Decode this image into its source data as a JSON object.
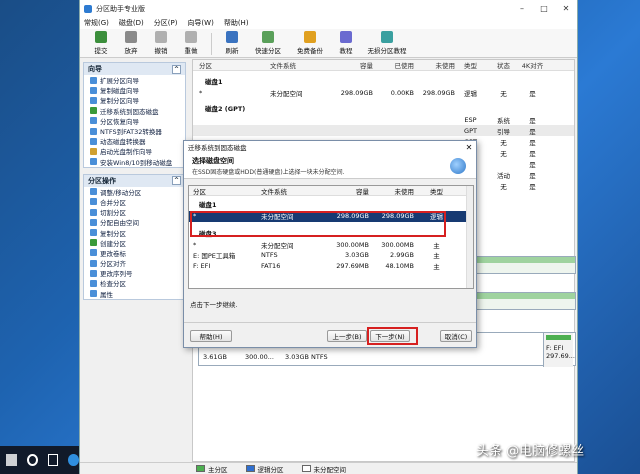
{
  "app": {
    "title": "分区助手专业版",
    "menu": [
      "常规(G)",
      "磁盘(D)",
      "分区(P)",
      "向导(W)",
      "帮助(H)"
    ],
    "toolbar": [
      "提交",
      "放弃",
      "撤销",
      "重做",
      "刷新",
      "快速分区",
      "免费备份",
      "教程",
      "无损分区教程"
    ]
  },
  "sidebar": {
    "wizard": {
      "title": "向导",
      "items": [
        "扩展分区向导",
        "复制磁盘向导",
        "复制分区向导",
        "迁移系统到固态磁盘",
        "分区恢复向导",
        "NTFS到FAT32转换器",
        "动态磁盘转换器",
        "启动光盘制作向导",
        "安装Win8/10到移动磁盘"
      ]
    },
    "ops": {
      "title": "分区操作",
      "items": [
        "调整/移动分区",
        "合并分区",
        "切割分区",
        "分配自由空间",
        "复制分区",
        "创建分区",
        "更改卷标",
        "分区对齐",
        "更改序列号",
        "检查分区",
        "属性"
      ]
    }
  },
  "grid": {
    "columns": [
      "分区",
      "文件系统",
      "容量",
      "已使用",
      "未使用",
      "类型",
      "状态",
      "4K对齐"
    ],
    "disk1_label": "磁盘1",
    "disk1_rows": [
      [
        "*",
        "未分配空间",
        "298.09GB",
        "0.00KB",
        "298.09GB",
        "逻辑",
        "无",
        "是"
      ]
    ],
    "disk2_label": "磁盘2 (GPT)",
    "disk2_rows": [
      [
        "",
        "",
        "",
        "",
        "",
        "ESP",
        "系统",
        "是"
      ],
      [
        "",
        "",
        "",
        "",
        "",
        "GPT",
        "引导",
        "是"
      ],
      [
        "",
        "",
        "",
        "",
        "",
        "GPT",
        "无",
        "是"
      ],
      [
        "",
        "",
        "",
        "",
        "",
        "逻辑",
        "无",
        "是"
      ],
      [
        "",
        "",
        "",
        "",
        "",
        "",
        "",
        "是"
      ],
      [
        "",
        "",
        "",
        "",
        "",
        "主",
        "活动",
        "是"
      ],
      [
        "",
        "",
        "",
        "",
        "",
        "主",
        "无",
        "是"
      ]
    ]
  },
  "map": {
    "bottom_left": "3.61GB",
    "bottom_mid": "300.00...",
    "bottom_fs": "3.03GB NTFS",
    "right_label": "F: EFI",
    "right_size": "297.69..."
  },
  "statusbar": {
    "legend": [
      "主分区",
      "逻辑分区",
      "未分配空间"
    ]
  },
  "dialog": {
    "title": "迁移系统到固态磁盘",
    "heading": "选择磁盘空间",
    "subheading": "在SSD固态硬盘或HDD(普通硬盘)上选择一块未分配空间.",
    "columns": [
      "分区",
      "文件系统",
      "容量",
      "未使用",
      "类型"
    ],
    "disk1_label": "磁盘1",
    "disk1_rows": [
      [
        "*",
        "未分配空间",
        "298.09GB",
        "298.09GB",
        "逻辑"
      ]
    ],
    "disk3_label": "磁盘3",
    "disk3_rows": [
      [
        "*",
        "未分配空间",
        "300.00MB",
        "300.00MB",
        "主"
      ],
      [
        "E: 国PE工具箱",
        "NTFS",
        "3.03GB",
        "2.99GB",
        "主"
      ],
      [
        "F: EFI",
        "FAT16",
        "297.69MB",
        "48.10MB",
        "主"
      ]
    ],
    "note": "点击下一步继续.",
    "help": "帮助(H)",
    "prev": "上一步(B)",
    "next": "下一步(N)",
    "cancel": "取消(C)"
  },
  "watermark": "头条 @电脑修螺丝"
}
